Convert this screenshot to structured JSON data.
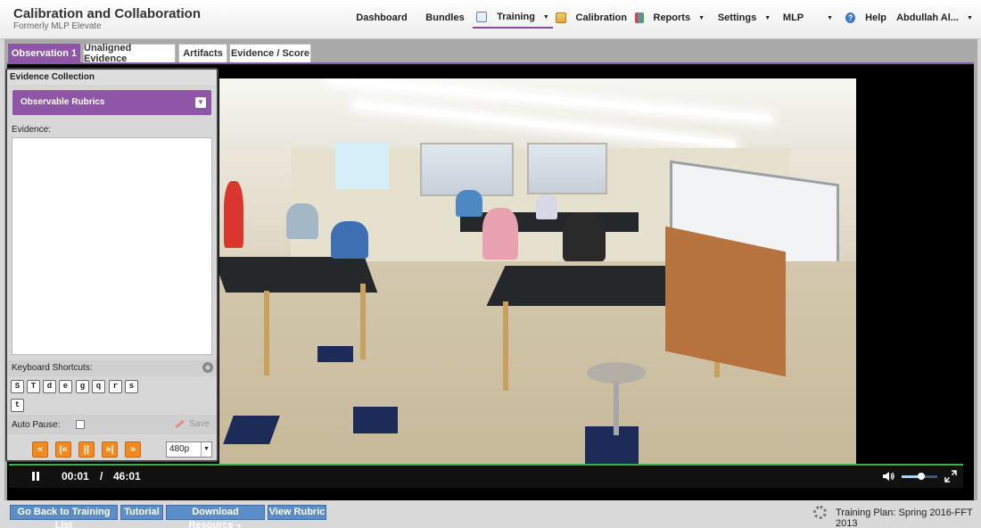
{
  "header": {
    "title": "Calibration and Collaboration",
    "subtitle": "Formerly MLP Elevate",
    "nav": {
      "dashboard": "Dashboard",
      "bundles": "Bundles",
      "training": "Training",
      "calibration": "Calibration",
      "reports": "Reports",
      "settings": "Settings",
      "mlp": "MLP",
      "help": "Help",
      "user": "Abdullah Al..."
    },
    "active_nav": "Training"
  },
  "tabs": {
    "observation": "Observation 1",
    "unaligned": "Unaligned Evidence",
    "artifacts": "Artifacts",
    "evidence_score": "Evidence / Score"
  },
  "panel": {
    "title": "Evidence Collection",
    "rubrics_button": "Observable Rubrics",
    "evidence_label": "Evidence:",
    "evidence_value": "",
    "shortcuts_label": "Keyboard Shortcuts:",
    "shortcut_keys": [
      "S",
      "T",
      "d",
      "e",
      "g",
      "q",
      "r",
      "s",
      "t"
    ],
    "autopause_label": "Auto Pause:",
    "autopause_checked": false,
    "save_label": "Save",
    "playback_buttons": [
      "«",
      "|«",
      "||",
      "»|",
      "»"
    ],
    "quality": "480p"
  },
  "player": {
    "current_time": "00:01",
    "separator": "/",
    "duration": "46:01",
    "volume": 0.55
  },
  "footer": {
    "back_button": "Go Back to Training List",
    "tutorial_button": "Tutorial",
    "download_button": "Download Resource",
    "rubric_button": "View Rubric",
    "training_plan": "Training Plan: Spring 2016-FFT 2013"
  },
  "colors": {
    "accent_purple": "#8f55a6",
    "button_blue": "#5b8ec8",
    "playback_orange": "#f48a1f",
    "progress_green": "#39b24a"
  }
}
